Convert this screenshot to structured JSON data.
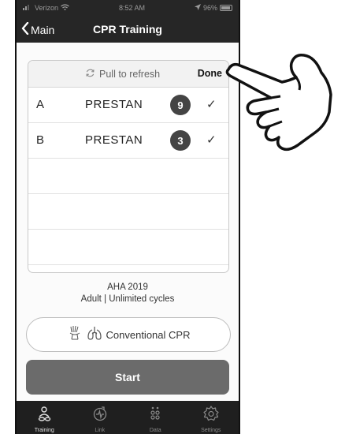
{
  "status_bar": {
    "carrier": "Verizon",
    "time": "8:52 AM",
    "battery": "96%"
  },
  "nav": {
    "back_label": "Main",
    "title": "CPR Training"
  },
  "table": {
    "refresh_label": "Pull to refresh",
    "done_label": "Done",
    "rows": [
      {
        "letter": "A",
        "name": "PRESTAN",
        "count": "9"
      },
      {
        "letter": "B",
        "name": "PRESTAN",
        "count": "3"
      }
    ]
  },
  "protocol": {
    "guideline": "AHA 2019",
    "mode": "Adult | Unlimited cycles"
  },
  "cpr_mode": {
    "label": "Conventional CPR"
  },
  "start": {
    "label": "Start"
  },
  "tabs": [
    {
      "label": "Training",
      "icon": "training-icon",
      "active": true
    },
    {
      "label": "Link",
      "icon": "link-icon",
      "active": false
    },
    {
      "label": "Data",
      "icon": "data-icon",
      "active": false
    },
    {
      "label": "Settings",
      "icon": "settings-icon",
      "active": false
    }
  ],
  "colors": {
    "nav_background": "#262626",
    "start_button": "#6b6b6b",
    "badge": "#444444"
  }
}
